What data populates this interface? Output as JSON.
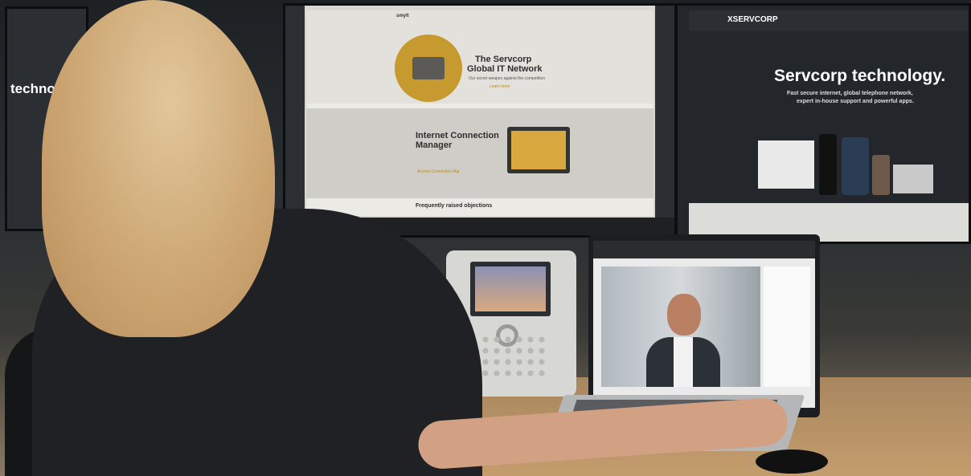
{
  "left_monitor": {
    "headline": "technology."
  },
  "center_monitor": {
    "brand": "smylt",
    "hero_title_line1": "The Servcorp",
    "hero_title_line2": "Global IT Network",
    "hero_sub": "Our secret weapon against the competition",
    "hero_link": "Learn more",
    "section_title_line1": "Internet Connection",
    "section_title_line2": "Manager",
    "section_link": "Access Connection Mgr",
    "faq_title": "Frequently raised objections"
  },
  "right_monitor": {
    "brand": "XSERVCORP",
    "headline": "Servcorp technology.",
    "sub_line1": "Fast secure internet, global telephone network,",
    "sub_line2": "expert in-house support and powerful apps."
  },
  "icons": [
    "globe-router-illustration",
    "laptop-illustration"
  ],
  "colors": {
    "accent_gold": "#c79a2f",
    "dark_ui": "#23272b"
  }
}
